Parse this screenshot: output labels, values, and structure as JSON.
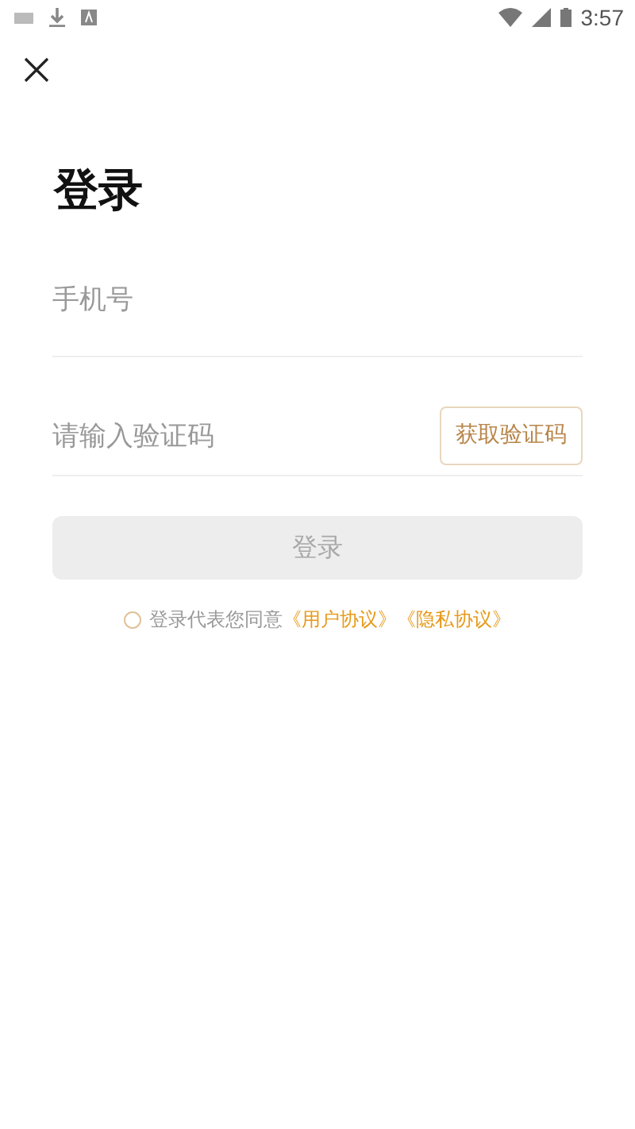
{
  "status_bar": {
    "time": "3:57"
  },
  "title": "登录",
  "phone_field": {
    "placeholder": "手机号"
  },
  "code_field": {
    "placeholder": "请输入验证码"
  },
  "get_code_button": "获取验证码",
  "login_button": {
    "label": "登录",
    "disabled": true
  },
  "agreement": {
    "checked": false,
    "text": "登录代表您同意",
    "links": [
      "《用户协议》",
      "《隐私协议》"
    ]
  }
}
